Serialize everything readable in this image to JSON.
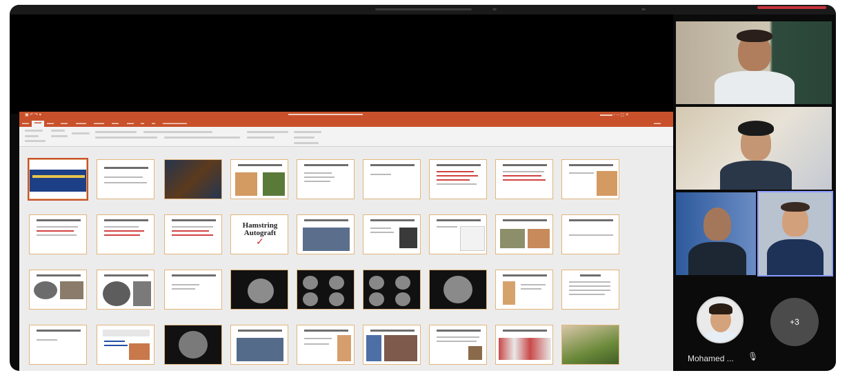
{
  "window": {
    "accent_color": "#c7323c",
    "frame_color": "#0b0b0b"
  },
  "powerpoint": {
    "accent_color": "#c8512b",
    "slide_title_texts": {
      "hamstring": "Hamstring Autograft"
    }
  },
  "participants": {
    "avatar_name": "Mohamed ...",
    "avatar_muted_icon": "mic-off-icon",
    "more_count": "+3"
  }
}
